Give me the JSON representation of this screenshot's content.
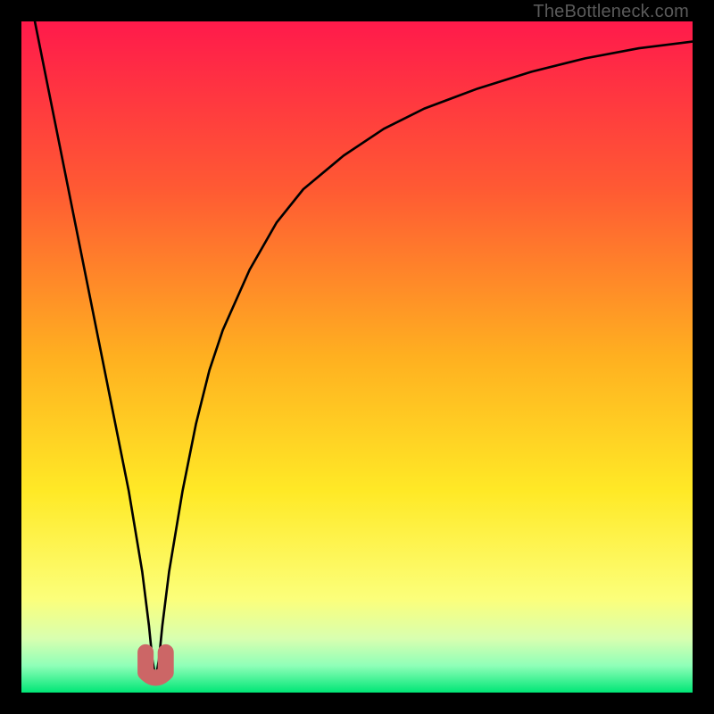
{
  "watermark": "TheBottleneck.com",
  "chart_data": {
    "type": "line",
    "title": "",
    "xlabel": "",
    "ylabel": "",
    "xlim": [
      0,
      100
    ],
    "ylim": [
      0,
      100
    ],
    "gradient_stops": [
      {
        "offset": 0,
        "color": "#ff1a4b"
      },
      {
        "offset": 0.25,
        "color": "#ff5a33"
      },
      {
        "offset": 0.5,
        "color": "#ffb020"
      },
      {
        "offset": 0.7,
        "color": "#ffe926"
      },
      {
        "offset": 0.86,
        "color": "#fcff7a"
      },
      {
        "offset": 0.92,
        "color": "#d8ffb0"
      },
      {
        "offset": 0.96,
        "color": "#8fffb8"
      },
      {
        "offset": 1.0,
        "color": "#00e676"
      }
    ],
    "series": [
      {
        "name": "bottleneck-curve",
        "color": "#000000",
        "x": [
          2,
          3,
          4,
          5,
          6,
          8,
          10,
          12,
          14,
          16,
          18,
          19,
          19.5,
          20,
          20.5,
          21,
          22,
          24,
          26,
          28,
          30,
          34,
          38,
          42,
          48,
          54,
          60,
          68,
          76,
          84,
          92,
          100
        ],
        "y": [
          100,
          95,
          90,
          85,
          80,
          70,
          60,
          50,
          40,
          30,
          18,
          10,
          5,
          2,
          5,
          10,
          18,
          30,
          40,
          48,
          54,
          63,
          70,
          75,
          80,
          84,
          87,
          90,
          92.5,
          94.5,
          96,
          97
        ]
      }
    ],
    "marker": {
      "name": "valley-marker",
      "shape": "u",
      "color": "#cc6666",
      "x": 20,
      "y": 2,
      "width": 3,
      "height": 4
    }
  }
}
